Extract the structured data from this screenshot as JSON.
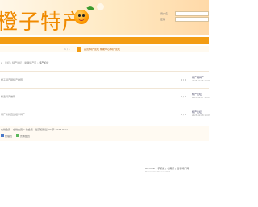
{
  "header": {
    "logo_text": "橙子特产",
    "login": {
      "username_label": "用户名",
      "password_label": "密码"
    }
  },
  "subnav": {
    "page_indicator": "1 / 1",
    "links": [
      "首页",
      "特产论坛",
      "帮助中心",
      "特产论坛"
    ]
  },
  "breadcrumb": {
    "home": "论坛",
    "parts": [
      "特产论坛",
      "新疆特产区",
      "特产论坛"
    ]
  },
  "threads": [
    {
      "title": "橙子特产网特产推荐",
      "stats": "0 / 3",
      "last_user": "特产网特产",
      "last_time": "2023-12-05 10:03"
    },
    {
      "title": "精选特产推荐",
      "stats": "0 / 2",
      "last_user": "特产论坛",
      "last_time": "2023-12-07 10:03"
    },
    {
      "title": "特产新鲜直送橙子特产",
      "stats": "0 / 3",
      "last_user": "特产论坛",
      "last_time": "2023-12-08 10:03"
    }
  ],
  "online": {
    "title": "在线会员 - 在线会员 1 位会员 - 最高纪录是 20 于 2023-5-11.",
    "legend": [
      "管理员",
      "普通会员"
    ]
  },
  "footer": {
    "links": "Archiver | 手机版 | 小黑屋 | 橙子特产网",
    "powered": "Powered by Discuz! X3.4"
  },
  "colors": {
    "accent": "#f39c12",
    "brand_orange": "#f08a00"
  }
}
